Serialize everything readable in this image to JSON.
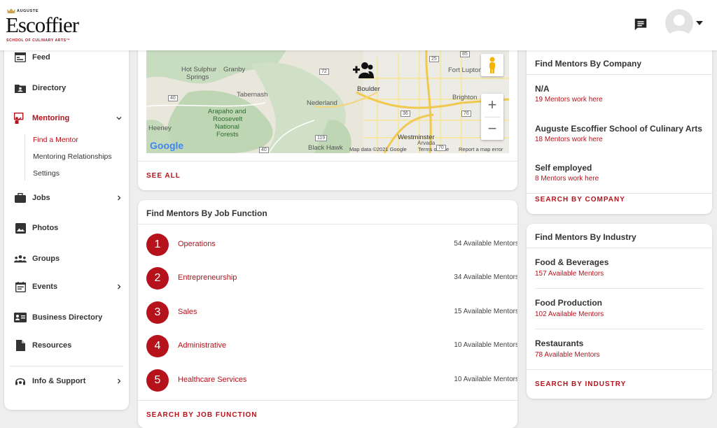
{
  "header": {
    "logo_top": "AUGUSTE",
    "logo_main": "Escoffier",
    "logo_sub": "SCHOOL OF CULINARY ARTS™"
  },
  "sidebar": {
    "items": [
      {
        "label": "Feed",
        "icon": "feed-icon"
      },
      {
        "label": "Directory",
        "icon": "directory-icon"
      },
      {
        "label": "Mentoring",
        "icon": "mentoring-icon"
      },
      {
        "label": "Jobs",
        "icon": "briefcase-icon"
      },
      {
        "label": "Photos",
        "icon": "photo-icon"
      },
      {
        "label": "Groups",
        "icon": "groups-icon"
      },
      {
        "label": "Events",
        "icon": "events-icon"
      },
      {
        "label": "Business Directory",
        "icon": "business-card-icon"
      },
      {
        "label": "Resources",
        "icon": "document-icon"
      },
      {
        "label": "Info & Support",
        "icon": "support-icon"
      }
    ],
    "mentoring_sub": [
      "Find a Mentor",
      "Mentoring Relationships",
      "Settings"
    ]
  },
  "map": {
    "labels": [
      "Hot Sulphur",
      "Springs",
      "Granby",
      "Tabernash",
      "Arapaho and",
      "Roosevelt",
      "National",
      "Forests",
      "Heeney",
      "Nederland",
      "Boulder",
      "Fort Lupton",
      "Brighton",
      "Westminster",
      "Arvada",
      "Black Hawk"
    ],
    "route_badges": [
      "25",
      "85",
      "72",
      "119",
      "36",
      "76",
      "40",
      "40",
      "70"
    ],
    "google": "Google",
    "attribution": [
      "Map data ©2021 Google",
      "Terms of Use",
      "Report a map error"
    ],
    "zoom_in": "+",
    "zoom_out": "−",
    "see_all": "SEE ALL"
  },
  "job_function": {
    "title": "Find Mentors By Job Function",
    "rows": [
      {
        "num": "1",
        "name": "Operations",
        "count": "54 Available Mentors"
      },
      {
        "num": "2",
        "name": "Entrepreneurship",
        "count": "34 Available Mentors"
      },
      {
        "num": "3",
        "name": "Sales",
        "count": "15 Available Mentors"
      },
      {
        "num": "4",
        "name": "Administrative",
        "count": "10 Available Mentors"
      },
      {
        "num": "5",
        "name": "Healthcare Services",
        "count": "10 Available Mentors"
      }
    ],
    "search": "SEARCH BY JOB FUNCTION"
  },
  "company": {
    "title": "Find Mentors By Company",
    "rows": [
      {
        "name": "N/A",
        "sub": "19 Mentors work here"
      },
      {
        "name": "Auguste Escoffier School of Culinary Arts",
        "sub": "18 Mentors work here"
      },
      {
        "name": "Self employed",
        "sub": "8 Mentors work here"
      }
    ],
    "search": "SEARCH BY COMPANY"
  },
  "industry": {
    "title": "Find Mentors By Industry",
    "rows": [
      {
        "name": "Food & Beverages",
        "sub": "157 Available Mentors"
      },
      {
        "name": "Food Production",
        "sub": "102 Available Mentors"
      },
      {
        "name": "Restaurants",
        "sub": "78 Available Mentors"
      }
    ],
    "search": "SEARCH BY INDUSTRY"
  },
  "colors": {
    "accent": "#b5121b",
    "background": "#eeeeee"
  }
}
